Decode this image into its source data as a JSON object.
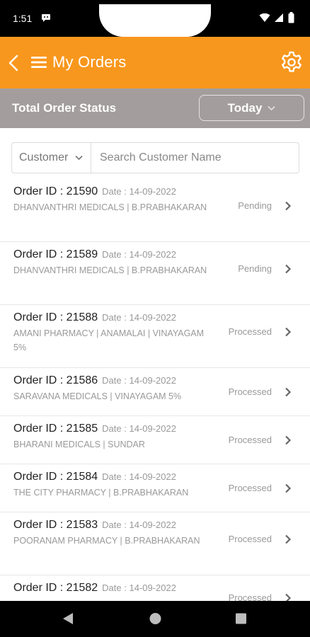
{
  "status_bar": {
    "time": "1:51"
  },
  "app_bar": {
    "title": "My Orders"
  },
  "status_row": {
    "label": "Total Order Status",
    "filter_value": "Today"
  },
  "search": {
    "filter_label": "Customer",
    "placeholder": "Search Customer Name"
  },
  "orders": [
    {
      "id": "Order ID : 21590",
      "date": "Date : 14-09-2022",
      "customer": "DHANVANTHRI MEDICALS | B.PRABHAKARAN",
      "status": "Pending"
    },
    {
      "id": "Order ID : 21589",
      "date": "Date : 14-09-2022",
      "customer": "DHANVANTHRI MEDICALS | B.PRABHAKARAN",
      "status": "Pending"
    },
    {
      "id": "Order ID : 21588",
      "date": "Date : 14-09-2022",
      "customer": "AMANI PHARMACY | ANAMALAI | VINAYAGAM 5%",
      "status": "Processed"
    },
    {
      "id": "Order ID : 21586",
      "date": "Date : 14-09-2022",
      "customer": "SARAVANA MEDICALS | VINAYAGAM 5%",
      "status": "Processed"
    },
    {
      "id": "Order ID : 21585",
      "date": "Date : 14-09-2022",
      "customer": "BHARANI MEDICALS | SUNDAR",
      "status": "Processed"
    },
    {
      "id": "Order ID : 21584",
      "date": "Date : 14-09-2022",
      "customer": "THE CITY PHARMACY | B.PRABHAKARAN",
      "status": "Processed"
    },
    {
      "id": "Order ID : 21583",
      "date": "Date : 14-09-2022",
      "customer": "POORANAM PHARMACY | B.PRABHAKARAN",
      "status": "Processed"
    },
    {
      "id": "Order ID : 21582",
      "date": "Date : 14-09-2022",
      "customer": "",
      "status": "Processed"
    }
  ],
  "colors": {
    "accent": "#f8971d",
    "status_row_bg": "#a39e9d"
  }
}
